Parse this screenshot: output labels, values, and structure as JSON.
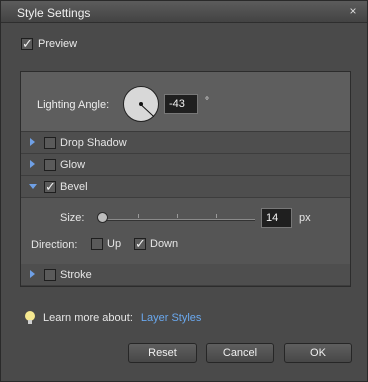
{
  "window": {
    "title": "Style Settings",
    "close_glyph": "×"
  },
  "preview": {
    "label": "Preview",
    "checked": true
  },
  "lighting": {
    "label": "Lighting Angle:",
    "value": "-43",
    "unit": "°"
  },
  "sections": {
    "drop_shadow": {
      "label": "Drop Shadow",
      "checked": false,
      "expanded": false
    },
    "glow": {
      "label": "Glow",
      "checked": false,
      "expanded": false
    },
    "bevel": {
      "label": "Bevel",
      "checked": true,
      "expanded": true
    },
    "stroke": {
      "label": "Stroke",
      "checked": false,
      "expanded": false
    }
  },
  "bevel": {
    "size_label": "Size:",
    "size_value": "14",
    "size_unit": "px",
    "direction_label": "Direction:",
    "up_label": "Up",
    "up_checked": false,
    "down_label": "Down",
    "down_checked": true
  },
  "learn": {
    "text": "Learn more about:",
    "link": "Layer Styles"
  },
  "buttons": {
    "reset": "Reset",
    "cancel": "Cancel",
    "ok": "OK"
  },
  "colors": {
    "link": "#6aa8ee",
    "expand_arrow": "#6fa0e6"
  }
}
